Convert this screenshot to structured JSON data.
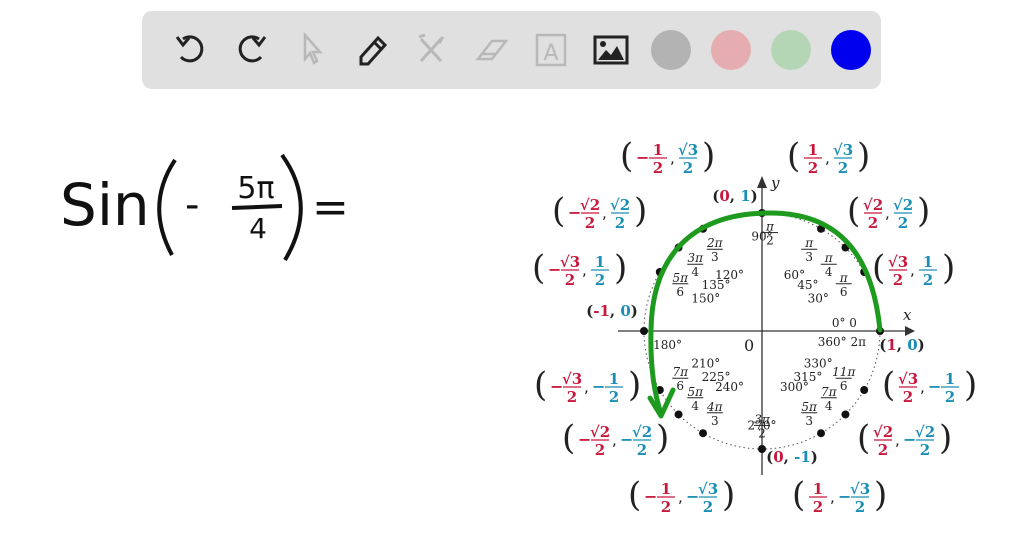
{
  "toolbar": {
    "tools": [
      {
        "name": "undo-icon",
        "label": "Undo",
        "enabled": true
      },
      {
        "name": "redo-icon",
        "label": "Redo",
        "enabled": true
      },
      {
        "name": "select-icon",
        "label": "Select",
        "enabled": false
      },
      {
        "name": "pen-icon",
        "label": "Pen",
        "enabled": true
      },
      {
        "name": "tools-icon",
        "label": "Tools",
        "enabled": false
      },
      {
        "name": "eraser-icon",
        "label": "Eraser",
        "enabled": false
      },
      {
        "name": "text-icon",
        "label": "Text",
        "enabled": false
      },
      {
        "name": "image-icon",
        "label": "Image",
        "enabled": true
      }
    ],
    "colors": [
      "#b3b3b3",
      "#e5adb0",
      "#b5d6b5",
      "#0000ee"
    ]
  },
  "handwriting": {
    "func": "Sin",
    "sign": "-",
    "num": "5π",
    "den": "4",
    "equals": "="
  },
  "circle": {
    "axis_x": "x",
    "axis_y": "y",
    "origin": "0",
    "accent_red": "#c8193c",
    "accent_blue": "#1a8fb5",
    "arrow_color": "#1e9a1e",
    "angles": [
      {
        "deg": "0° 0",
        "rad": "",
        "a": 0
      },
      {
        "deg": "30°",
        "rad": [
          "π",
          "6"
        ],
        "a": 30
      },
      {
        "deg": "45°",
        "rad": [
          "π",
          "4"
        ],
        "a": 45
      },
      {
        "deg": "60°",
        "rad": [
          "π",
          "3"
        ],
        "a": 60
      },
      {
        "deg": "90°",
        "rad": [
          "π",
          "2"
        ],
        "a": 90
      },
      {
        "deg": "120°",
        "rad": [
          "2π",
          "3"
        ],
        "a": 120
      },
      {
        "deg": "135°",
        "rad": [
          "3π",
          "4"
        ],
        "a": 135
      },
      {
        "deg": "150°",
        "rad": [
          "5π",
          "6"
        ],
        "a": 150
      },
      {
        "deg": "180°",
        "rad": "π",
        "a": 180
      },
      {
        "deg": "210°",
        "rad": [
          "7π",
          "6"
        ],
        "a": 210
      },
      {
        "deg": "225°",
        "rad": [
          "5π",
          "4"
        ],
        "a": 225
      },
      {
        "deg": "240°",
        "rad": [
          "4π",
          "3"
        ],
        "a": 240
      },
      {
        "deg": "270°",
        "rad": [
          "3π",
          "2"
        ],
        "a": 270
      },
      {
        "deg": "300°",
        "rad": [
          "5π",
          "3"
        ],
        "a": 300
      },
      {
        "deg": "315°",
        "rad": [
          "7π",
          "4"
        ],
        "a": 315
      },
      {
        "deg": "330°",
        "rad": [
          "11π",
          "6"
        ],
        "a": 330
      },
      {
        "deg": "360° 2π",
        "rad": "",
        "a": 360
      }
    ],
    "coords": [
      {
        "a": 0,
        "x": [
          "1"
        ],
        "y": [
          "0"
        ]
      },
      {
        "a": 30,
        "x": [
          "√3",
          "2"
        ],
        "y": [
          "1",
          "2"
        ]
      },
      {
        "a": 45,
        "x": [
          "√2",
          "2"
        ],
        "y": [
          "√2",
          "2"
        ]
      },
      {
        "a": 60,
        "x": [
          "1",
          "2"
        ],
        "y": [
          "√3",
          "2"
        ]
      },
      {
        "a": 90,
        "x": [
          "0"
        ],
        "y": [
          "1"
        ]
      },
      {
        "a": 120,
        "x": [
          "-",
          "1",
          "2"
        ],
        "y": [
          "√3",
          "2"
        ]
      },
      {
        "a": 135,
        "x": [
          "-",
          "√2",
          "2"
        ],
        "y": [
          "√2",
          "2"
        ]
      },
      {
        "a": 150,
        "x": [
          "-",
          "√3",
          "2"
        ],
        "y": [
          "1",
          "2"
        ]
      },
      {
        "a": 180,
        "x": [
          "-1"
        ],
        "y": [
          "0"
        ]
      },
      {
        "a": 210,
        "x": [
          "-",
          "√3",
          "2"
        ],
        "y": [
          "-",
          "1",
          "2"
        ]
      },
      {
        "a": 225,
        "x": [
          "-",
          "√2",
          "2"
        ],
        "y": [
          "-",
          "√2",
          "2"
        ]
      },
      {
        "a": 240,
        "x": [
          "-",
          "1",
          "2"
        ],
        "y": [
          "-",
          "√3",
          "2"
        ]
      },
      {
        "a": 270,
        "x": [
          "0"
        ],
        "y": [
          "-1"
        ]
      },
      {
        "a": 300,
        "x": [
          "1",
          "2"
        ],
        "y": [
          "-",
          "√3",
          "2"
        ]
      },
      {
        "a": 315,
        "x": [
          "√2",
          "2"
        ],
        "y": [
          "-",
          "√2",
          "2"
        ]
      },
      {
        "a": 330,
        "x": [
          "√3",
          "2"
        ],
        "y": [
          "-",
          "1",
          "2"
        ]
      }
    ]
  }
}
